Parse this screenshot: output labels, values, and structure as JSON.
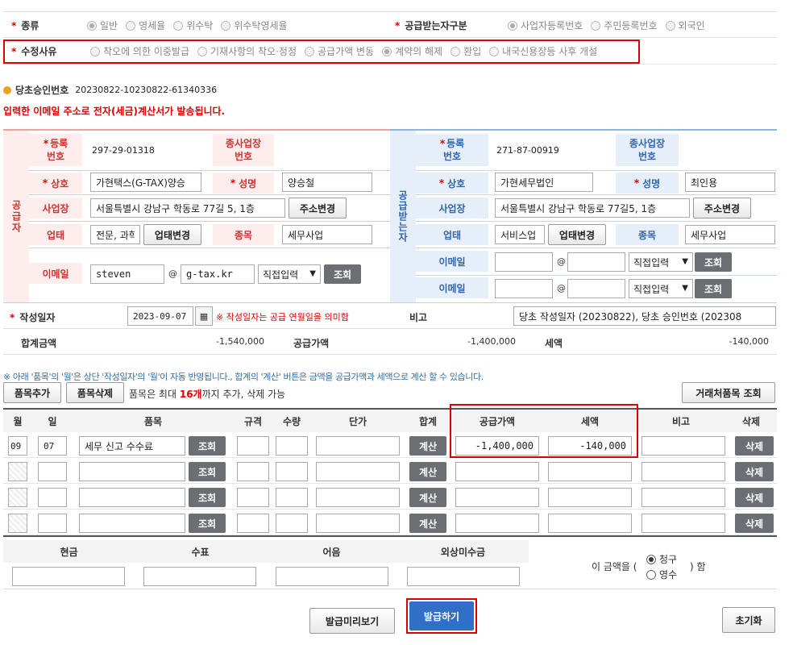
{
  "top": {
    "kind_label": "종류",
    "kind_options": [
      "일반",
      "영세율",
      "위수탁",
      "위수탁영세율"
    ],
    "recv_kind_label": "공급받는자구분",
    "recv_kind_options": [
      "사업자등록번호",
      "주민등록번호",
      "외국인"
    ],
    "reason_label": "수정사유",
    "reason_options": [
      "착오에 의한 이중발급",
      "기재사항의 착오·정정",
      "공급가액 변동",
      "계약의 해제",
      "환입",
      "내국신용장등 사후 개설"
    ]
  },
  "original": {
    "label": "당초승인번호",
    "value": "20230822-10230822-61340336"
  },
  "notice": "입력한 이메일 주소로 전자(세금)계산서가 발송됩니다.",
  "supplier": {
    "side": "공급자",
    "reg_label": "등록\n번호",
    "reg_value": "297-29-01318",
    "branch_label": "종사업장\n번호",
    "name_label": "상호",
    "name_value": "가현택스(G-TAX)양승",
    "rep_label": "성명",
    "rep_value": "양승철",
    "addr_label": "사업장",
    "addr_value": "서울특별시 강남구 학동로 77길 5, 1층",
    "addr_btn": "주소변경",
    "biz_label": "업태",
    "biz_value": "전문, 과학",
    "biz_btn": "업태변경",
    "item_label": "종목",
    "item_value": "세무사업",
    "email_label": "이메일",
    "email_id": "steven",
    "email_domain": "g-tax.kr",
    "email_select": "직접입력",
    "lookup": "조회"
  },
  "receiver": {
    "side": "공급받는자",
    "reg_label": "등록\n번호",
    "reg_value": "271-87-00919",
    "branch_label": "종사업장\n번호",
    "name_label": "상호",
    "name_value": "가현세무법인",
    "rep_label": "성명",
    "rep_value": "최인용",
    "addr_label": "사업장",
    "addr_value": "서울특별시 강남구 학동로 77길5, 1층",
    "addr_btn": "주소변경",
    "biz_label": "업태",
    "biz_value": "서비스업",
    "biz_btn": "업태변경",
    "item_label": "종목",
    "item_value": "세무사업",
    "email_label": "이메일",
    "email_select": "직접입력",
    "lookup": "조회"
  },
  "date": {
    "label": "작성일자",
    "value": "2023-09-07",
    "note": "※ 작성일자는 공급 연월일을 의미함",
    "memo_label": "비고",
    "memo_value": "당초 작성일자 (20230822), 당초 승인번호 (202308"
  },
  "sum": {
    "total_label": "합계금액",
    "total": "-1,540,000",
    "supply_label": "공급가액",
    "supply": "-1,400,000",
    "tax_label": "세액",
    "tax": "-140,000"
  },
  "hint": "※ 아래 '품목'의 '월'은 상단 '작성일자'의 '월'이 자동 반영됩니다., 합계의 '계산' 버튼은 금액을 공급가액과 세액으로 계산 할 수 있습니다.",
  "items_bar": {
    "add": "품목추가",
    "del": "품목삭제",
    "note_pre": "품목은 최대 ",
    "note_max": "16개",
    "note_post": "까지 추가, 삭제 가능",
    "partner": "거래처품목 조회"
  },
  "cols": [
    "월",
    "일",
    "품목",
    "규격",
    "수량",
    "단가",
    "합계",
    "공급가액",
    "세액",
    "비고",
    "삭제"
  ],
  "rows": [
    {
      "month": "09",
      "day": "07",
      "item": "세무 신고 수수료",
      "supply": "-1,400,000",
      "tax": "-140,000"
    },
    {
      "month": "",
      "day": "",
      "item": "",
      "supply": "",
      "tax": ""
    },
    {
      "month": "",
      "day": "",
      "item": "",
      "supply": "",
      "tax": ""
    },
    {
      "month": "",
      "day": "",
      "item": "",
      "supply": "",
      "tax": ""
    }
  ],
  "row_btns": {
    "lookup": "조회",
    "calc": "계산",
    "delete": "삭제"
  },
  "pay": {
    "cols": [
      "현금",
      "수표",
      "어음",
      "외상미수금"
    ],
    "claim_pre": "이 금액을 (",
    "claim_post": ") 함",
    "claim": "청구",
    "receipt": "영수"
  },
  "footer": {
    "preview": "발급미리보기",
    "issue": "발급하기",
    "reset": "초기화"
  }
}
